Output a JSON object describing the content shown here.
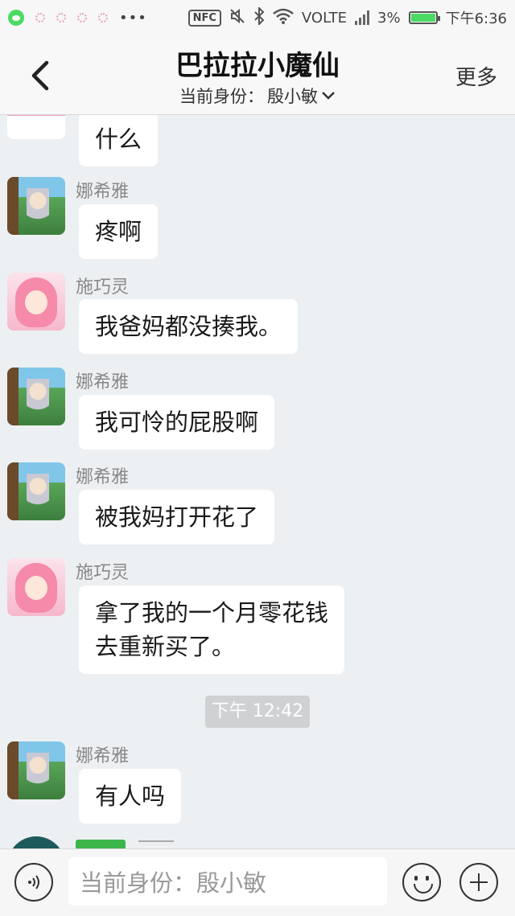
{
  "status_bar": {
    "nfc": "NFC",
    "network": "VOLTE",
    "battery": "3%",
    "time": "下午6:36",
    "dots": "•••"
  },
  "header": {
    "title": "巴拉拉小魔仙",
    "identity_label": "当前身份：",
    "identity_name": "殷小敏",
    "more": "更多"
  },
  "messages": [
    {
      "sender": "",
      "text": "什么",
      "avatar": "avatar-top"
    },
    {
      "sender": "娜希雅",
      "text": "疼啊",
      "avatar": "avatar-naxiya"
    },
    {
      "sender": "施巧灵",
      "text": "我爸妈都没揍我。",
      "avatar": "avatar-shiqiaoling"
    },
    {
      "sender": "娜希雅",
      "text": "我可怜的屁股啊",
      "avatar": "avatar-naxiya"
    },
    {
      "sender": "娜希雅",
      "text": "被我妈打开花了",
      "avatar": "avatar-naxiya"
    },
    {
      "sender": "施巧灵",
      "text": "拿了我的一个月零花钱\n去重新买了。",
      "avatar": "avatar-shiqiaoling"
    },
    {
      "sender": "娜希雅",
      "text": "有人吗",
      "avatar": "avatar-naxiya"
    }
  ],
  "timestamp": "下午 12:42",
  "input": {
    "placeholder": "当前身份：殷小敏"
  },
  "colors": {
    "background": "#edf0f2",
    "bubble": "#ffffff",
    "accent_green": "#3cb64b"
  },
  "icons": [
    "back-arrow-icon",
    "chevron-down-icon",
    "voice-icon",
    "emoji-icon",
    "plus-icon"
  ]
}
